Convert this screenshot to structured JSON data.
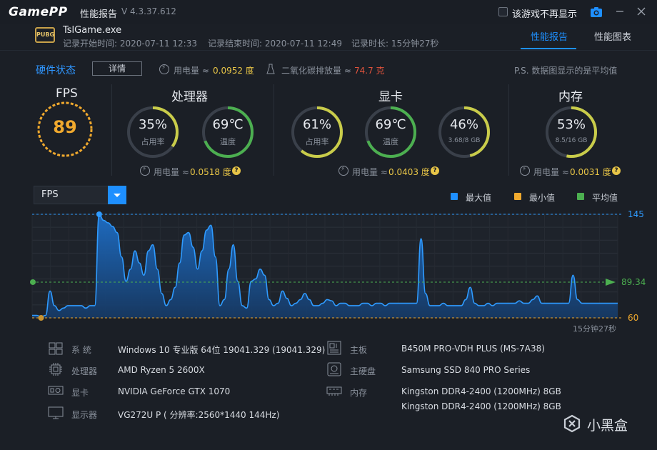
{
  "titlebar": {
    "logo": "GamePP",
    "title": "性能报告",
    "version": "V 4.3.37.612",
    "dont_show_label": "该游戏不再显示"
  },
  "session": {
    "game_icon_text": "PUBG",
    "exe": "TslGame.exe",
    "start": "记录开始时间: 2020-07-11 12:33",
    "end": "记录结束时间: 2020-07-11 12:49",
    "duration": "记录时长: 15分钟27秒"
  },
  "tabs": [
    {
      "label": "性能报告",
      "active": true
    },
    {
      "label": "性能图表",
      "active": false
    }
  ],
  "hardware_state": {
    "title": "硬件状态",
    "detail_btn": "详情",
    "power_label": "用电量 ≈",
    "power_value": "0.0952 度",
    "co2_label": "二氧化碳排放量 ≈",
    "co2_value": "74.7 克",
    "note": "P.S. 数据图显示的是平均值"
  },
  "sections": {
    "fps": {
      "title": "FPS",
      "value": "89"
    },
    "cpu": {
      "title": "处理器",
      "usage": {
        "value": "35%",
        "label": "占用率",
        "fraction": 0.35
      },
      "temp": {
        "value": "69℃",
        "label": "温度",
        "fraction": 0.69
      },
      "power_label": "用电量 ≈",
      "power_value": "0.0518 度"
    },
    "gpu": {
      "title": "显卡",
      "usage": {
        "value": "61%",
        "label": "占用率",
        "fraction": 0.61
      },
      "temp": {
        "value": "69℃",
        "label": "温度",
        "fraction": 0.69
      },
      "vram": {
        "value": "46%",
        "label": "3.68/8 GB",
        "fraction": 0.46
      },
      "power_label": "用电量 ≈",
      "power_value": "0.0403 度"
    },
    "mem": {
      "title": "内存",
      "usage": {
        "value": "53%",
        "label": "8.5/16 GB",
        "fraction": 0.53
      },
      "power_label": "用电量 ≈",
      "power_value": "0.0031 度"
    }
  },
  "chart": {
    "selected": "FPS",
    "legend": [
      {
        "label": "最大值",
        "color": "#1e8fff"
      },
      {
        "label": "最小值",
        "color": "#f0a92e"
      },
      {
        "label": "平均值",
        "color": "#4caf50"
      }
    ],
    "max_label": "145",
    "avg_label": "89.34",
    "min_label": "60",
    "duration_label": "15分钟27秒"
  },
  "chart_data": {
    "type": "area",
    "ylim": [
      60,
      145
    ],
    "max": 145,
    "min": 60,
    "avg": 89.34,
    "values": [
      62,
      62,
      61,
      62,
      82,
      70,
      66,
      68,
      70,
      70,
      70,
      70,
      68,
      70,
      70,
      145,
      140,
      138,
      135,
      130,
      110,
      90,
      100,
      115,
      105,
      95,
      115,
      120,
      100,
      80,
      70,
      75,
      85,
      105,
      128,
      130,
      118,
      100,
      115,
      132,
      136,
      110,
      70,
      75,
      100,
      120,
      90,
      70,
      68,
      90,
      92,
      100,
      95,
      75,
      70,
      72,
      82,
      76,
      70,
      72,
      75,
      80,
      75,
      70,
      70,
      72,
      75,
      74,
      70,
      72,
      72,
      70,
      70,
      70,
      72,
      72,
      70,
      72,
      72,
      70,
      72,
      72,
      72,
      72,
      72,
      72,
      72,
      125,
      80,
      70,
      70,
      70,
      72,
      70,
      70,
      70,
      70,
      75,
      85,
      72,
      70,
      70,
      72,
      70,
      72,
      72,
      72,
      72,
      72,
      74,
      72,
      72,
      75,
      78,
      72,
      72,
      72,
      72,
      72,
      72,
      72,
      95,
      75,
      72,
      72,
      72,
      72,
      72,
      72,
      72,
      72,
      72
    ]
  },
  "sysinfo": {
    "left": [
      {
        "icon": "windows-icon",
        "key": "系   统",
        "value": "Windows 10 专业版 64位   19041.329 (19041.329)"
      },
      {
        "icon": "cpu-icon",
        "key": "处理器",
        "value": "AMD Ryzen 5 2600X"
      },
      {
        "icon": "gpu-icon",
        "key": "显卡",
        "value": "NVIDIA GeForce GTX 1070"
      },
      {
        "icon": "monitor-icon",
        "key": "显示器",
        "value": "VG272U P ( 分辨率:2560*1440 144Hz)"
      }
    ],
    "right": [
      {
        "icon": "motherboard-icon",
        "key": "主板",
        "value": "B450M PRO-VDH PLUS (MS-7A38)"
      },
      {
        "icon": "disk-icon",
        "key": "主硬盘",
        "value": "Samsung SSD 840 PRO Series"
      },
      {
        "icon": "memory-icon",
        "key": "内存",
        "value": "Kingston DDR4-2400 (1200MHz) 8GB"
      },
      {
        "icon": "",
        "key": "",
        "value": "Kingston DDR4-2400 (1200MHz) 8GB"
      }
    ]
  },
  "watermark": {
    "text": "小黑盒"
  }
}
